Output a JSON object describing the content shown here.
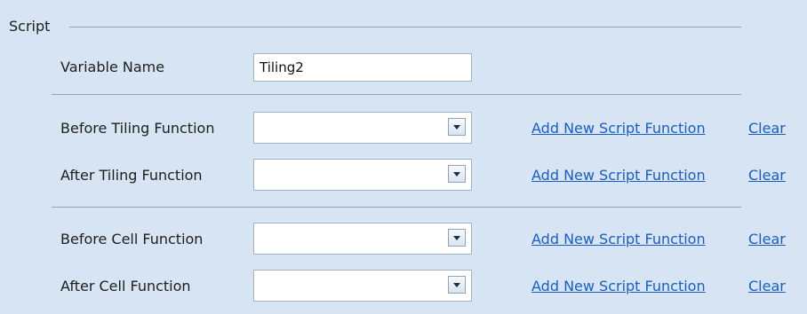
{
  "section": {
    "title": "Script"
  },
  "variable": {
    "label": "Variable Name",
    "value": "Tiling2"
  },
  "functions": [
    {
      "label": "Before Tiling Function",
      "value": "",
      "add_label": "Add New Script Function",
      "clear_label": "Clear"
    },
    {
      "label": "After Tiling Function",
      "value": "",
      "add_label": "Add New Script Function",
      "clear_label": "Clear"
    },
    {
      "label": "Before Cell Function",
      "value": "",
      "add_label": "Add New Script Function",
      "clear_label": "Clear"
    },
    {
      "label": "After Cell Function",
      "value": "",
      "add_label": "Add New Script Function",
      "clear_label": "Clear"
    }
  ],
  "icons": {
    "dropdown": "chevron-down-icon"
  },
  "colors": {
    "background": "#d7e4f3",
    "link": "#1a5fc0",
    "rule": "#9aa2ad"
  }
}
